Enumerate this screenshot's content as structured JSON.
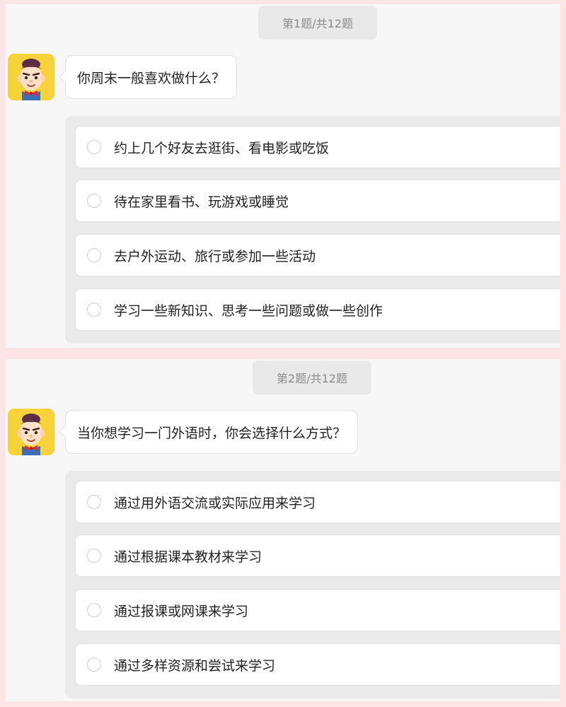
{
  "questions": [
    {
      "counter": "第1题/共12题",
      "question": "你周末一般喜欢做什么？",
      "options": [
        "约上几个好友去逛街、看电影或吃饭",
        "待在家里看书、玩游戏或睡觉",
        "去户外运动、旅行或参加一些活动",
        "学习一些新知识、思考一些问题或做一些创作"
      ]
    },
    {
      "counter": "第2题/共12题",
      "question": "当你想学习一门外语时，你会选择什么方式？",
      "options": [
        "通过用外语交流或实际应用来学习",
        "通过根据课本教材来学习",
        "通过报课或网课来学习",
        "通过多样资源和尝试来学习"
      ]
    }
  ],
  "avatar": {
    "icon": "cartoon-boy-avatar-icon",
    "background_color": "#f8d23a"
  },
  "colors": {
    "page_background": "#fde4e6",
    "panel_background": "#f7f7f7",
    "options_group_background": "#eaeaea",
    "counter_background": "#e9e9e9"
  }
}
